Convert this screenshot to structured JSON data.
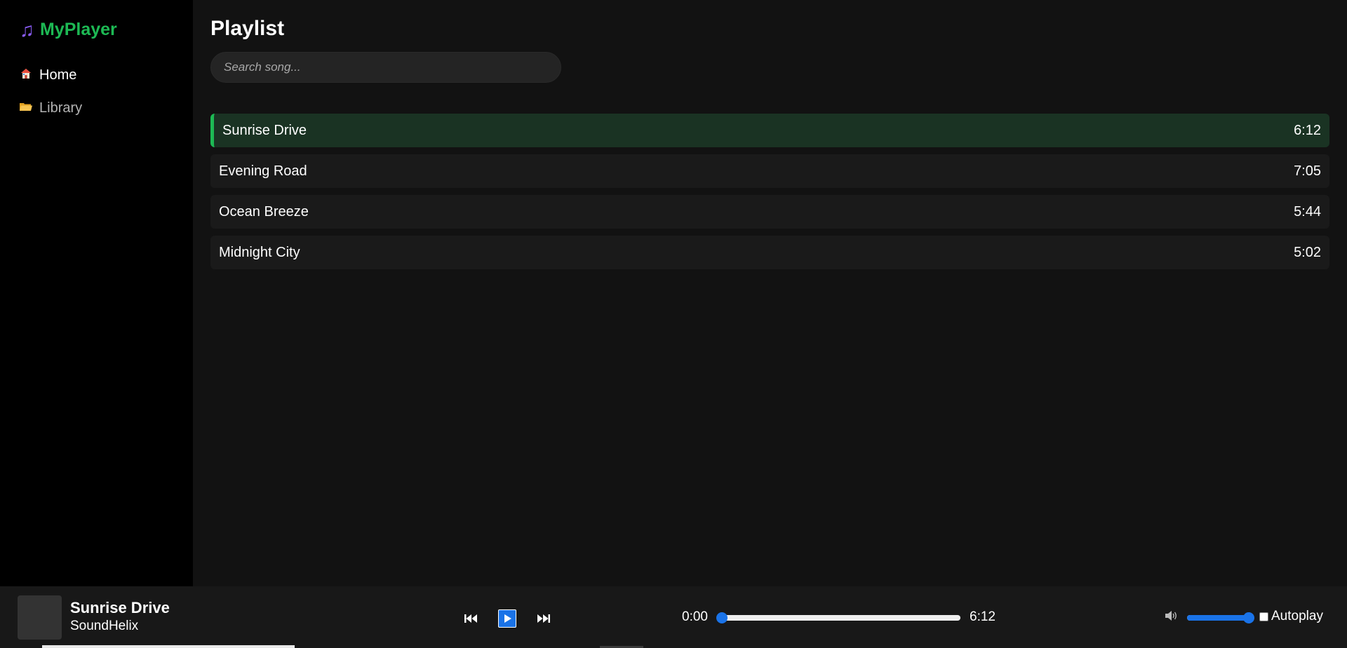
{
  "sidebar": {
    "logo_icon": "music-note-icon",
    "logo_text": "MyPlayer",
    "items": [
      {
        "icon": "house-icon",
        "label": "Home"
      },
      {
        "icon": "folder-icon",
        "label": "Library"
      }
    ]
  },
  "main": {
    "title": "Playlist",
    "search_placeholder": "Search song...",
    "tracks": [
      {
        "title": "Sunrise Drive",
        "duration": "6:12",
        "active": true
      },
      {
        "title": "Evening Road",
        "duration": "7:05",
        "active": false
      },
      {
        "title": "Ocean Breeze",
        "duration": "5:44",
        "active": false
      },
      {
        "title": "Midnight City",
        "duration": "5:02",
        "active": false
      }
    ]
  },
  "player": {
    "now_playing_title": "Sunrise Drive",
    "now_playing_artist": "SoundHelix",
    "controls": {
      "prev_icon": "skip-back-icon",
      "play_icon": "play-icon",
      "next_icon": "skip-forward-icon"
    },
    "current_time": "0:00",
    "total_time": "6:12",
    "progress_fraction": 0.0,
    "volume_icon": "speaker-icon",
    "volume_fraction": 1.0,
    "autoplay_label": "Autoplay",
    "autoplay_checked": false
  },
  "colors": {
    "accent": "#1db954",
    "control_blue": "#1a73e8",
    "active_row": "#1a3323"
  }
}
